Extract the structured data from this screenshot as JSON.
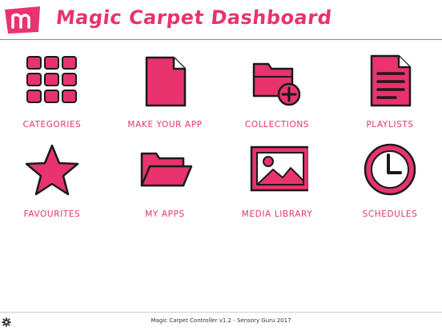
{
  "header": {
    "title": "Magic Carpet Dashboard",
    "logo_icon": "magic-carpet-logo-icon"
  },
  "tiles": [
    {
      "label": "CATEGORIES",
      "icon": "grid-icon"
    },
    {
      "label": "MAKE YOUR APP",
      "icon": "blank-page-icon"
    },
    {
      "label": "COLLECTIONS",
      "icon": "folder-add-icon"
    },
    {
      "label": "PLAYLISTS",
      "icon": "document-lines-icon"
    },
    {
      "label": "FAVOURITES",
      "icon": "star-icon"
    },
    {
      "label": "MY APPS",
      "icon": "open-folder-icon"
    },
    {
      "label": "MEDIA LIBRARY",
      "icon": "image-icon"
    },
    {
      "label": "SCHEDULES",
      "icon": "clock-icon"
    }
  ],
  "footer": {
    "text": "Magic Carpet Controller v1.2 - Sensory Guru 2017",
    "settings_icon": "gear-icon"
  },
  "colors": {
    "accent": "#e8336e",
    "outline": "#1a1a1a",
    "background": "#ffffff"
  }
}
